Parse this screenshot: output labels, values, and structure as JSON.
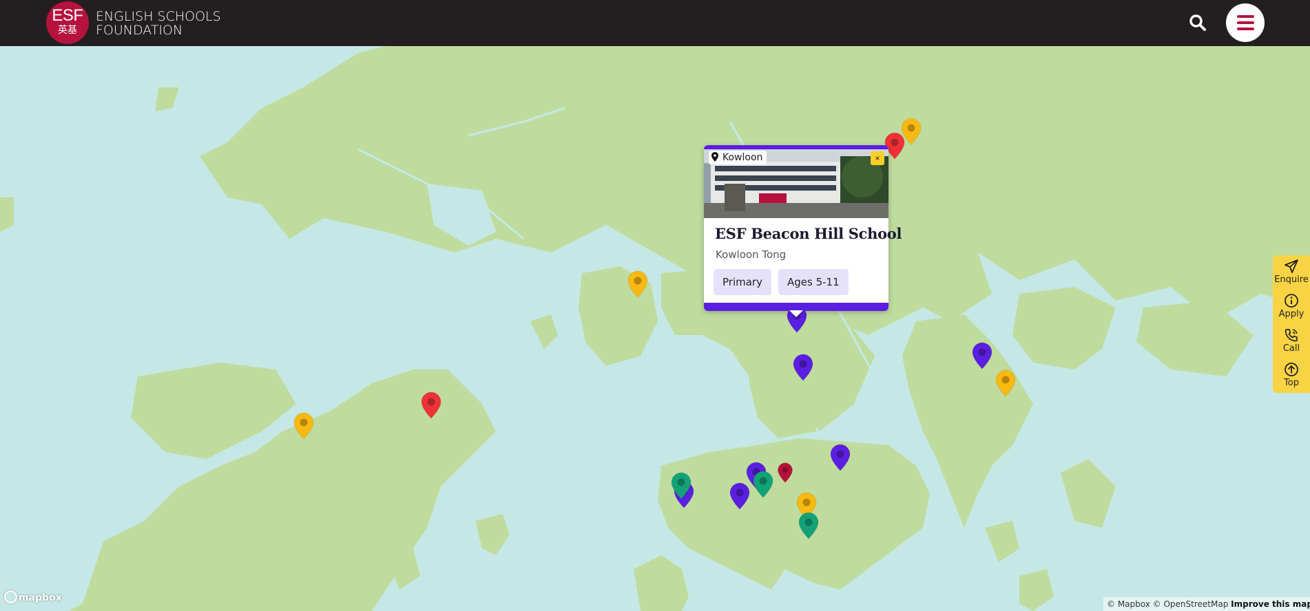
{
  "header": {
    "logo_line1": "ESF",
    "logo_line2": "英基",
    "org_line1": "ENGLISH SCHOOLS",
    "org_line2": "FOUNDATION"
  },
  "popup": {
    "location_label": "Kowloon",
    "close_label": "×",
    "school_name": "ESF Beacon Hill School",
    "area": "Kowloon Tong",
    "tags": [
      "Primary",
      "Ages 5-11"
    ]
  },
  "sidebar": {
    "items": [
      {
        "label": "Enquire",
        "icon": "send-icon"
      },
      {
        "label": "Apply",
        "icon": "info-icon"
      },
      {
        "label": "Call",
        "icon": "phone-icon"
      },
      {
        "label": "Top",
        "icon": "arrow-up-icon"
      }
    ]
  },
  "map": {
    "attribution": {
      "mapbox": "© Mapbox",
      "osm": "© OpenStreetMap",
      "improve": "Improve this map"
    },
    "brand": "mapbox",
    "colors": {
      "water": "#c5e8e6",
      "land": "#bfdc9e",
      "marker_yellow": "#f8b912",
      "marker_red": "#ee3236",
      "marker_purple": "#5a1fe0",
      "marker_green": "#13a277",
      "marker_crimson": "#b5123e"
    },
    "markers": [
      {
        "color": "yellow"
      },
      {
        "color": "red"
      },
      {
        "color": "yellow"
      },
      {
        "color": "purple"
      },
      {
        "color": "purple"
      },
      {
        "color": "purple"
      },
      {
        "color": "yellow"
      },
      {
        "color": "red"
      },
      {
        "color": "yellow"
      },
      {
        "color": "purple"
      },
      {
        "color": "green"
      },
      {
        "color": "purple"
      },
      {
        "color": "green"
      },
      {
        "color": "purple"
      },
      {
        "color": "crimson"
      },
      {
        "color": "purple"
      },
      {
        "color": "yellow"
      },
      {
        "color": "green"
      }
    ]
  }
}
